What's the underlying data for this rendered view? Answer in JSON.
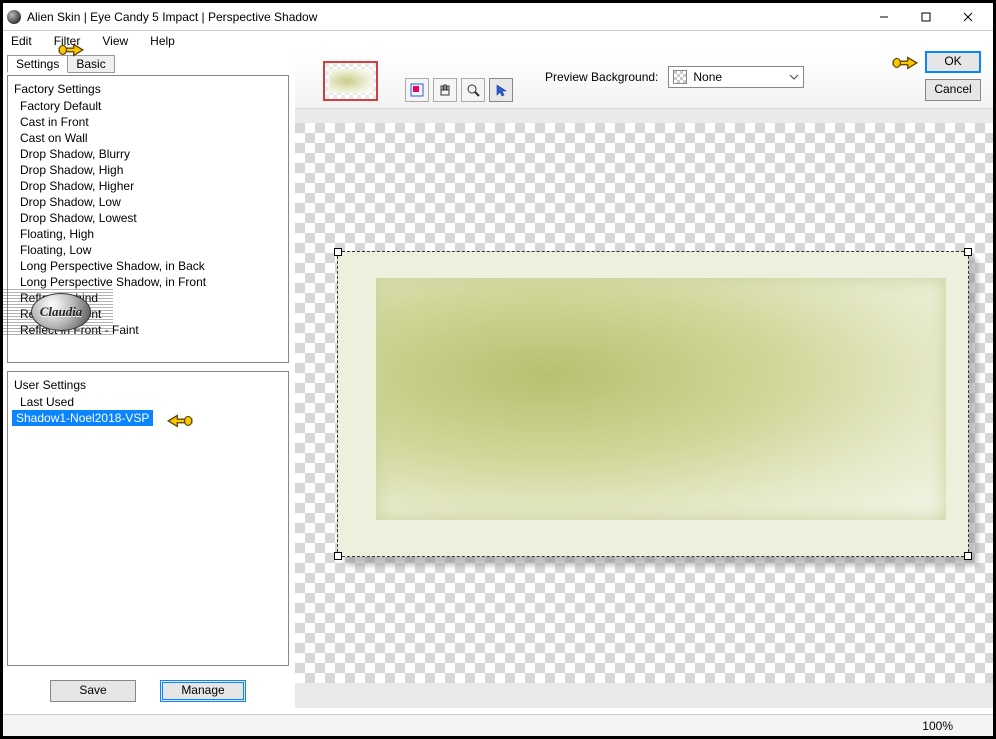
{
  "window": {
    "title": "Alien Skin | Eye Candy 5 Impact | Perspective Shadow"
  },
  "menu": {
    "edit": "Edit",
    "filter": "Filter",
    "view": "View",
    "help": "Help"
  },
  "tabs": {
    "settings": "Settings",
    "basic": "Basic"
  },
  "factory": {
    "header": "Factory Settings",
    "items": [
      "Factory Default",
      "Cast in Front",
      "Cast on Wall",
      "Drop Shadow, Blurry",
      "Drop Shadow, High",
      "Drop Shadow, Higher",
      "Drop Shadow, Low",
      "Drop Shadow, Lowest",
      "Floating, High",
      "Floating, Low",
      "Long Perspective Shadow, in Back",
      "Long Perspective Shadow, in Front",
      "Reflect Behind",
      "Reflect in Front",
      "Reflect in Front - Faint"
    ]
  },
  "user": {
    "header": "User Settings",
    "items": [
      "Last Used",
      "Shadow1-Noel2018-VSP"
    ],
    "selected_index": 1
  },
  "buttons": {
    "save": "Save",
    "manage": "Manage",
    "ok": "OK",
    "cancel": "Cancel"
  },
  "preview": {
    "bg_label": "Preview Background:",
    "bg_value": "None"
  },
  "status": {
    "zoom": "100%"
  },
  "watermark": {
    "text": "Claudia"
  },
  "icons": {
    "minimize": "min",
    "maximize": "max",
    "close": "close",
    "nav": "select-all-icon",
    "hand": "hand-tool-icon",
    "zoom": "zoom-tool-icon",
    "arrow": "arrow-tool-icon"
  }
}
